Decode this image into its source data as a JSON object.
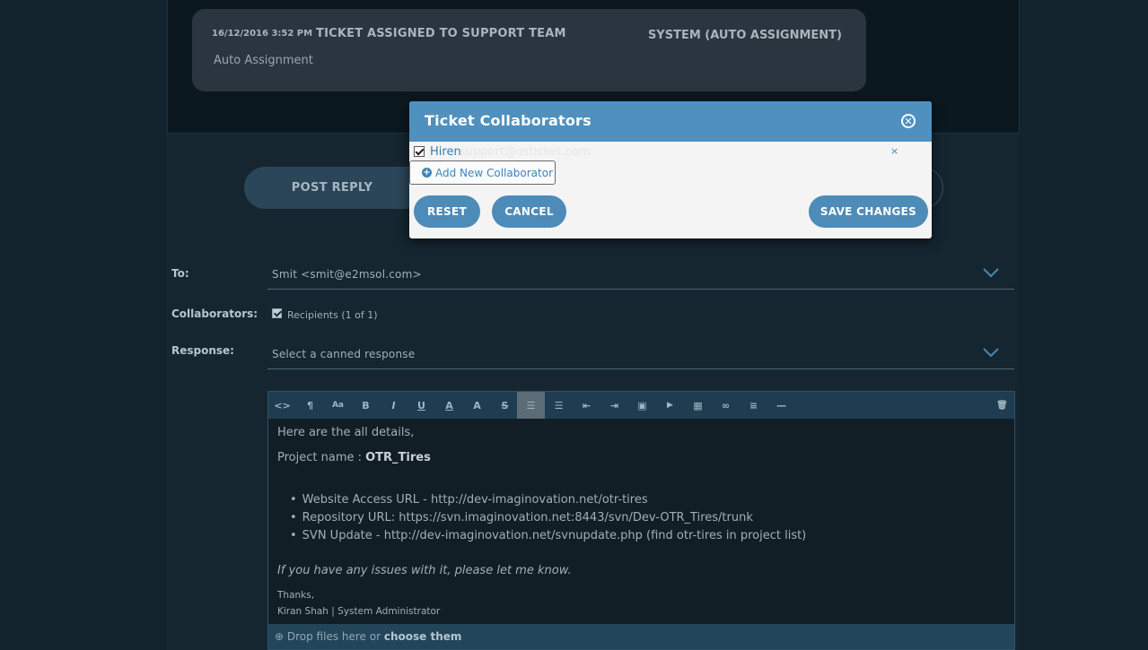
{
  "thread": {
    "timestamp": "16/12/2016 3:52 PM",
    "title": "TICKET ASSIGNED TO SUPPORT TEAM",
    "author": "SYSTEM (AUTO ASSIGNMENT)",
    "body": "Auto Assignment"
  },
  "tabs": {
    "post_reply": "POST REPLY"
  },
  "form": {
    "to_label": "To:",
    "to_value": "Smit <smit@e2msol.com>",
    "collaborators_label": "Collaborators:",
    "collaborators_value": "Recipients (1 of 1)",
    "response_label": "Response:",
    "response_placeholder": "Select a canned response"
  },
  "editor": {
    "toolbar": [
      "html-icon",
      "paragraph-icon",
      "font-size-icon",
      "bold-icon",
      "italic-icon",
      "underline-icon",
      "font-color-icon",
      "highlight-icon",
      "strikethrough-icon",
      "unordered-list-icon",
      "ordered-list-icon",
      "outdent-icon",
      "indent-icon",
      "image-icon",
      "video-icon",
      "table-icon",
      "link-icon",
      "align-icon",
      "horizontal-rule-icon",
      "trash-icon"
    ],
    "toolbar_glyphs": [
      "<>",
      "¶",
      "Aa",
      "B",
      "I",
      "U",
      "A",
      "A",
      "S",
      "☰",
      "☰",
      "⇤",
      "⇥",
      "▣",
      "▶",
      "▦",
      "∞",
      "≡",
      "—",
      "🗑"
    ],
    "line1": "Here are the all details,",
    "line2_prefix": "Project name : ",
    "line2_bold": "OTR_Tires",
    "bullets": [
      "Website Access URL - http://dev-imaginovation.net/otr-tires",
      "Repository URL: https://svn.imaginovation.net:8443/svn/Dev-OTR_Tires/trunk",
      "SVN Update - http://dev-imaginovation.net/svnupdate.php (find otr-tires in project list)"
    ],
    "issue_line": "If you have any issues with it, please let me know.",
    "thanks": "Thanks,",
    "signature": "Kiran Shah | System Administrator",
    "drop_prefix": "Drop files here or ",
    "drop_link": "choose them"
  },
  "modal": {
    "title": "Ticket Collaborators",
    "close_glyph": "✕",
    "collaborator_name": "Hiren",
    "collaborator_email": "support@osticket.com",
    "remove_glyph": "×",
    "add_label": "Add New Collaborator",
    "reset_label": "RESET",
    "cancel_label": "CANCEL",
    "save_label": "SAVE CHANGES"
  },
  "colors": {
    "accent": "#4f90bf",
    "background": "#0f1c24"
  }
}
